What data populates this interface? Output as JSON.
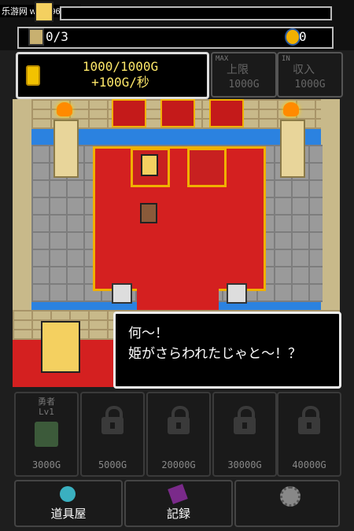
{
  "watermark": "乐游网 www.962.net",
  "status": {
    "hero_count": "0/3",
    "soul_count": "0"
  },
  "gold": {
    "amount": "1000/1000G",
    "rate": "+100G/秒"
  },
  "upgrades": [
    {
      "tag": "MAX",
      "label": "上限",
      "cost": "1000G"
    },
    {
      "tag": "IN",
      "label": "収入",
      "cost": "1000G"
    }
  ],
  "dialog": {
    "text": "何～！\n姫がさらわれたじゃと～！？"
  },
  "hero_slots": [
    {
      "name": "勇者",
      "level": "Lv1",
      "cost": "3000G",
      "locked": false
    },
    {
      "cost": "5000G",
      "locked": true
    },
    {
      "cost": "20000G",
      "locked": true
    },
    {
      "cost": "30000G",
      "locked": true
    },
    {
      "cost": "40000G",
      "locked": true
    }
  ],
  "bottom_buttons": [
    {
      "label": "道具屋",
      "icon": "potion-icon"
    },
    {
      "label": "記録",
      "icon": "book-icon"
    },
    {
      "label": "",
      "icon": "gear-icon"
    }
  ],
  "colors": {
    "gold_text": "#ffe96a",
    "carpet": "#d42020",
    "trim": "#f0b000",
    "water": "#2b82e0"
  }
}
